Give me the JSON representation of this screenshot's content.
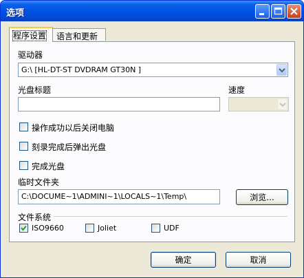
{
  "window": {
    "title": "选项"
  },
  "tabs": [
    {
      "label": "程序设置",
      "active": true
    },
    {
      "label": "语言和更新",
      "active": false
    }
  ],
  "drive": {
    "label": "驱动器",
    "selected": "G:\\ [HL-DT-ST DVDRAM GT30N    ]"
  },
  "disc_title": {
    "label": "光盘标题",
    "value": ""
  },
  "speed": {
    "label": "速度",
    "value": ""
  },
  "options": [
    {
      "label": "操作成功以后关闭电脑",
      "checked": false
    },
    {
      "label": "刻录完成后弹出光盘",
      "checked": false
    },
    {
      "label": "完成光盘",
      "checked": false
    }
  ],
  "temp_folder": {
    "label": "临时文件夹",
    "value": "C:\\DOCUME~1\\ADMINI~1\\LOCALS~1\\Temp\\",
    "browse_label": "浏览..."
  },
  "filesystem": {
    "label": "文件系统",
    "items": [
      {
        "label": "ISO9660",
        "checked": true
      },
      {
        "label": "Joliet",
        "checked": false
      },
      {
        "label": "UDF",
        "checked": false
      }
    ]
  },
  "footer": {
    "ok_label": "确定",
    "cancel_label": "取消"
  }
}
